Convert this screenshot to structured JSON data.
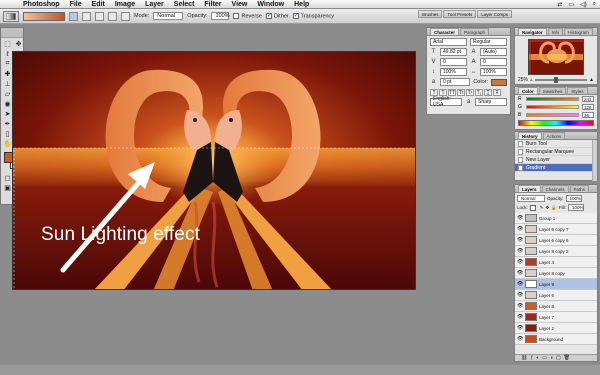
{
  "menubar": {
    "app": "Photoshop",
    "items": [
      "File",
      "Edit",
      "Image",
      "Layer",
      "Select",
      "Filter",
      "View",
      "Window",
      "Help"
    ]
  },
  "options": {
    "mode_label": "Mode:",
    "mode_value": "Normal",
    "opacity_label": "Opacity:",
    "opacity_value": "100%",
    "reverse": "Reverse",
    "dither": "Dither",
    "transparency": "Transparency",
    "wells": [
      "Brushes",
      "Tool Presets",
      "Layer Comps"
    ]
  },
  "canvas": {
    "callout": "Sun Lighting effect"
  },
  "character": {
    "tabs": [
      "Character",
      "Paragraph"
    ],
    "font": "Arial",
    "style": "Regular",
    "size": "49.82 pt",
    "leading": "(Auto)",
    "kerning": "0",
    "tracking": "0",
    "vscale": "100%",
    "hscale": "100%",
    "baseline": "0 pt",
    "color_label": "Color:",
    "language": "English: USA",
    "aa": "Sharp"
  },
  "navigator": {
    "tabs": [
      "Navigator",
      "Info",
      "Histogram"
    ],
    "zoom": "25%"
  },
  "color": {
    "tabs": [
      "Color",
      "Swatches",
      "Styles"
    ],
    "rows": [
      {
        "letter": "R",
        "value": "241"
      },
      {
        "letter": "G",
        "value": "126"
      },
      {
        "letter": "B",
        "value": "36"
      }
    ]
  },
  "history": {
    "tabs": [
      "History",
      "Actions"
    ],
    "items": [
      "Burn Tool",
      "Rectangular Marquee",
      "New Layer",
      "Gradient"
    ]
  },
  "layers": {
    "tabs": [
      "Layers",
      "Channels",
      "Paths"
    ],
    "blend": "Normal",
    "opacity_label": "Opacity:",
    "opacity": "100%",
    "lock_label": "Lock:",
    "fill_label": "Fill:",
    "fill": "100%",
    "items": [
      {
        "name": "Group 1",
        "color": "#c0c0c0"
      },
      {
        "name": "Layer 6 copy 7",
        "color": "#e0d0c0"
      },
      {
        "name": "Layer 6 copy 6",
        "color": "#e0d0c0"
      },
      {
        "name": "Layer 8 copy 2",
        "color": "#d8d0c8"
      },
      {
        "name": "Layer 4",
        "color": "#b04020"
      },
      {
        "name": "Layer 8 copy",
        "color": "#d8d0c8"
      },
      {
        "name": "Layer 9",
        "color": "#ffffff"
      },
      {
        "name": "Layer 6",
        "color": "#e0d0c0"
      },
      {
        "name": "Layer 8",
        "color": "#c86028"
      },
      {
        "name": "Layer 7",
        "color": "#a02818"
      },
      {
        "name": "Layer 2",
        "color": "#8a1a10"
      },
      {
        "name": "Background",
        "color": "#c05018"
      }
    ]
  }
}
